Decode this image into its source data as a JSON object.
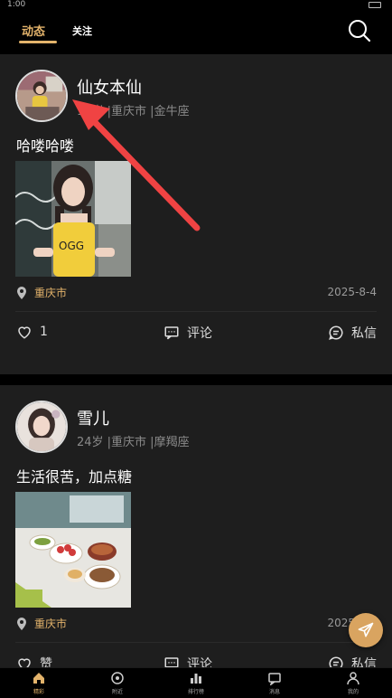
{
  "status_bar": {
    "time": "1:00"
  },
  "header": {
    "tabs": [
      {
        "label": "动态",
        "active": true
      },
      {
        "label": "关注",
        "active": false
      }
    ],
    "search_icon": "search-icon"
  },
  "posts": [
    {
      "name": "仙女本仙",
      "meta": "18岁 |重庆市 |金牛座",
      "text": "哈喽哈喽",
      "location": "重庆市",
      "date": "2025-8-4",
      "likes": "1",
      "comment_label": "评论",
      "message_label": "私信"
    },
    {
      "name": "雪儿",
      "meta": "24岁 |重庆市 |摩羯座",
      "text": "生活很苦，加点糖",
      "location": "重庆市",
      "date": "2025-8-4",
      "likes": "赞",
      "comment_label": "评论",
      "message_label": "私信"
    }
  ],
  "bottom_nav": [
    {
      "label": "精彩",
      "icon": "home-icon",
      "active": true
    },
    {
      "label": "附近",
      "icon": "nearby-icon",
      "active": false
    },
    {
      "label": "排行榜",
      "icon": "ranking-icon",
      "active": false
    },
    {
      "label": "消息",
      "icon": "message-icon",
      "active": false
    },
    {
      "label": "我的",
      "icon": "profile-icon",
      "active": false
    }
  ],
  "colors": {
    "accent": "#e3b36b",
    "card": "#1e1e1e",
    "background": "#000000",
    "annotation_arrow": "#f04343"
  }
}
